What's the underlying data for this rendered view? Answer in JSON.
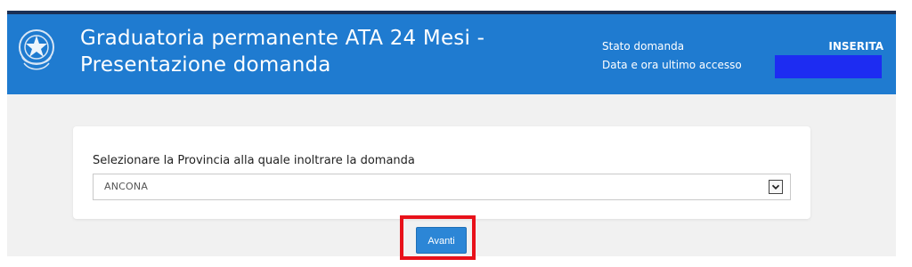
{
  "header": {
    "title": "Graduatoria permanente ATA 24 Mesi - Presentazione domanda",
    "status_label": "Stato domanda",
    "status_value": "INSERITA",
    "last_access_label": "Data e ora ultimo accesso",
    "emblem_icon": "italian-republic-emblem-icon",
    "background_color": "#1f7bd0"
  },
  "form": {
    "province_label": "Selezionare la Provincia alla quale inoltrare la domanda",
    "province_value": "ANCONA",
    "dropdown_icon": "chevron-down-icon"
  },
  "actions": {
    "next_label": "Avanti",
    "highlight_color": "#e8111a"
  }
}
